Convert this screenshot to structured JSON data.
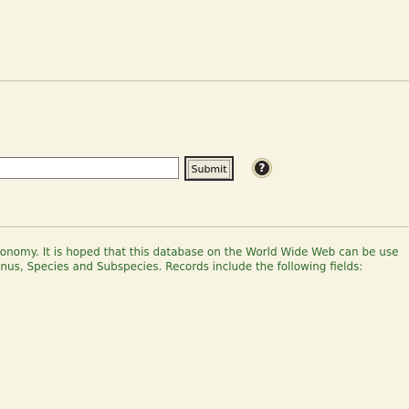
{
  "search": {
    "value": "",
    "submit_label": "Submit",
    "help_icon": "help-icon",
    "help_glyph": "?"
  },
  "intro": {
    "line1": "xonomy. It is hoped that this database on the World Wide Web can be use",
    "line2": "enus, Species and Subspecies. Records include the following fields:"
  },
  "colors": {
    "background": "#f8f4e3",
    "text": "#2e6b2a",
    "rule": "#c9c2a9"
  }
}
